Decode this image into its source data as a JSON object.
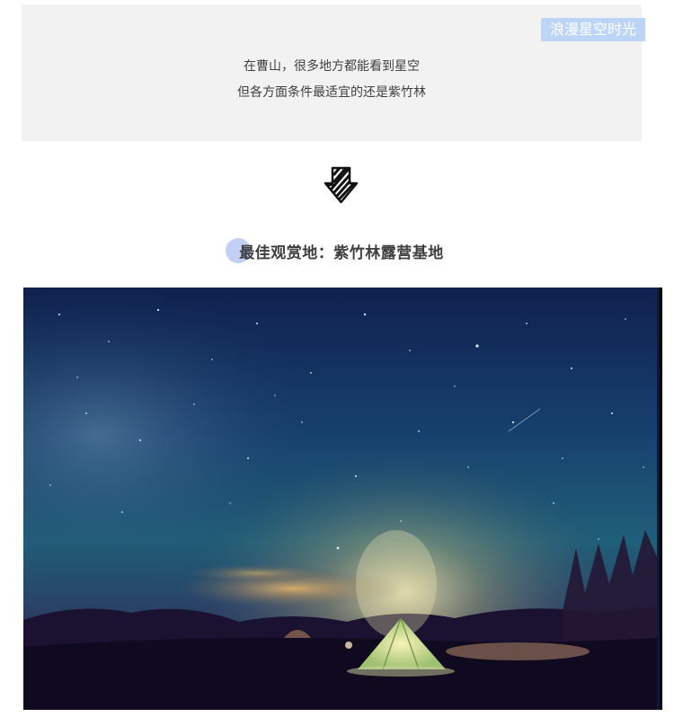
{
  "intro": {
    "tag": "浪漫星空时光",
    "line1": "在曹山，很多地方都能看到星空",
    "line2": "但各方面条件最适宜的还是紫竹林"
  },
  "section": {
    "heading": "最佳观赏地：紫竹林露营基地"
  },
  "icons": {
    "arrow": "hatched-down-arrow-icon"
  },
  "colors": {
    "tag_bg": "#bcd4f5",
    "box_bg": "#f2f2f2",
    "heading_dot": "#c3cff5",
    "text": "#3f3f3f"
  }
}
